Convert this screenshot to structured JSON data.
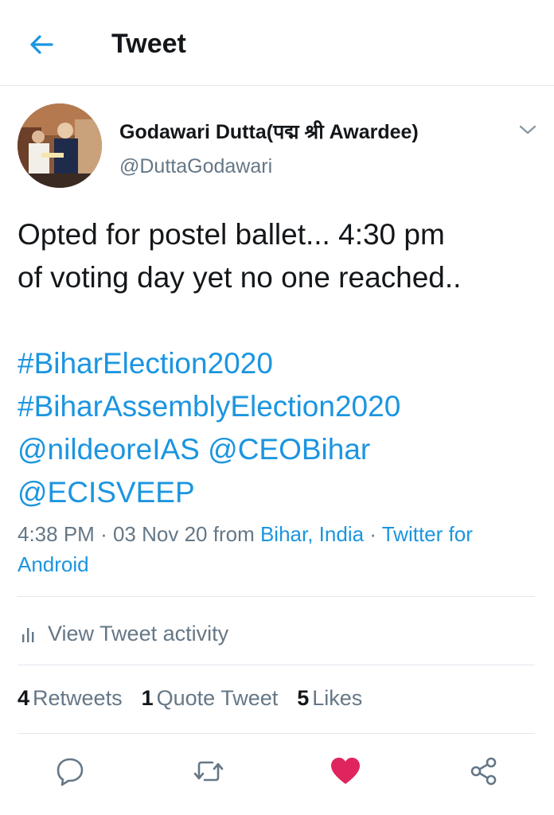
{
  "header": {
    "title": "Tweet"
  },
  "author": {
    "name": "Godawari Dutta(पद्म श्री Awardee)",
    "handle": "@DuttaGodawari"
  },
  "tweet": {
    "text_lines": [
      "Opted for postel ballet... 4:30 pm",
      "of voting day yet no one reached.."
    ],
    "hashtags": [
      "#BiharElection2020",
      "#BiharAssemblyElection2020"
    ],
    "mentions": [
      "@nildeoreIAS",
      "@CEOBihar",
      "@ECISVEEP"
    ]
  },
  "meta": {
    "time": "4:38 PM",
    "date": "03 Nov 20",
    "from_label": "from",
    "location": "Bihar, India",
    "separator": "·",
    "client_part1": "Twitter for",
    "client_part2": "Android"
  },
  "activity": {
    "label": "View Tweet activity"
  },
  "stats": {
    "retweets_count": "4",
    "retweets_label": "Retweets",
    "quotes_count": "1",
    "quotes_label": "Quote Tweet",
    "likes_count": "5",
    "likes_label": "Likes"
  },
  "colors": {
    "accent": "#1b95e0",
    "like": "#e0245e",
    "secondary_text": "#657786"
  },
  "icons": {
    "back": "arrow-left-icon",
    "chevron": "chevron-down-icon",
    "activity": "bar-chart-icon",
    "reply": "reply-icon",
    "retweet": "retweet-icon",
    "like": "heart-icon",
    "share": "share-icon"
  }
}
